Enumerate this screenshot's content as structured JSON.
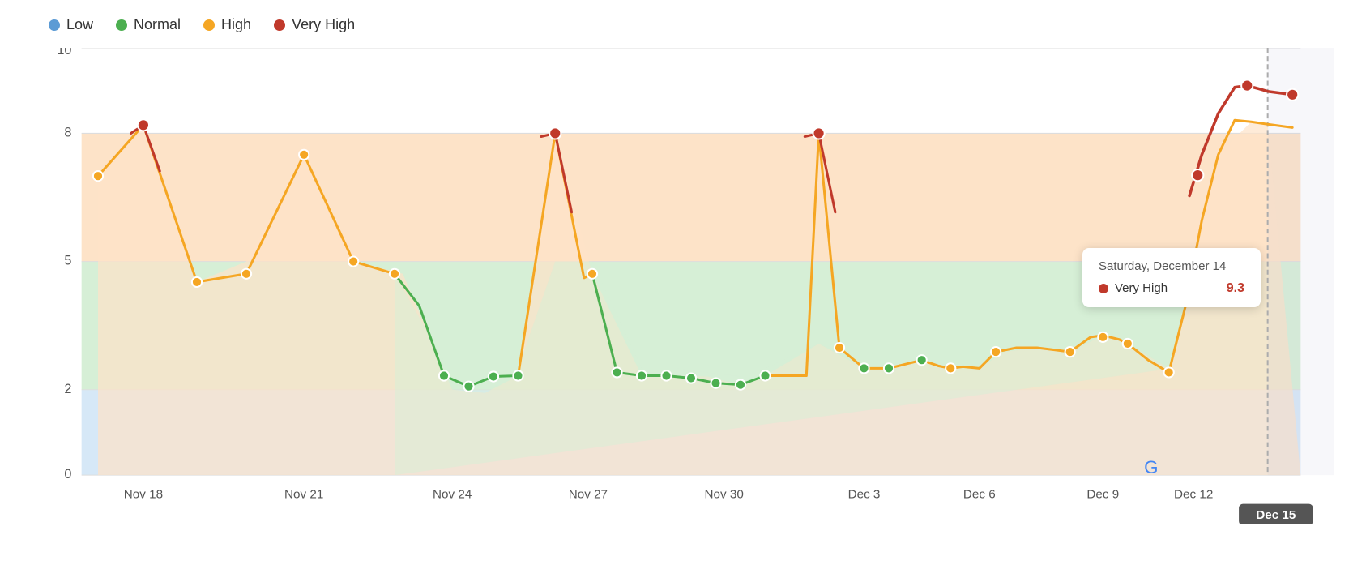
{
  "legend": {
    "items": [
      {
        "label": "Low",
        "color": "#5b9bd5",
        "id": "low"
      },
      {
        "label": "Normal",
        "color": "#4caf50",
        "id": "normal"
      },
      {
        "label": "High",
        "color": "#f5a623",
        "id": "high"
      },
      {
        "label": "Very High",
        "color": "#c0392b",
        "id": "very-high"
      }
    ]
  },
  "yAxis": {
    "ticks": [
      0,
      2,
      5,
      8,
      10
    ]
  },
  "xAxis": {
    "labels": [
      "Nov 18",
      "Nov 21",
      "Nov 24",
      "Nov 27",
      "Nov 30",
      "Dec 3",
      "Dec 6",
      "Dec 9",
      "Dec 12",
      "Dec 15"
    ]
  },
  "bands": {
    "low": {
      "color": "#d6e8f7",
      "min": 0,
      "max": 2
    },
    "normal": {
      "color": "#d6efd6",
      "min": 2,
      "max": 5
    },
    "high": {
      "color": "#fde3c8",
      "min": 5,
      "max": 8
    },
    "very_high": {
      "color": "#f7cccc",
      "min": 8,
      "max": 10
    }
  },
  "tooltip": {
    "title": "Saturday, December 14",
    "label": "Very High",
    "value": "9.3",
    "dot_color": "#c0392b"
  },
  "dec15_badge": "Dec 15",
  "google_logo": "G"
}
